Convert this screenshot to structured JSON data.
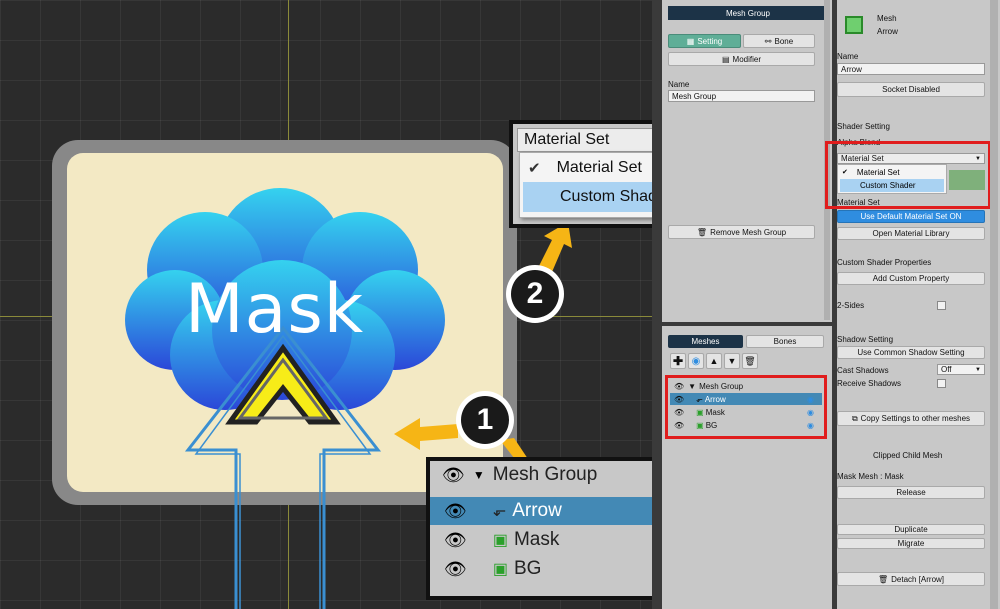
{
  "viewport": {
    "mask_label": "Mask",
    "callout1_number": "1",
    "callout2_number": "2"
  },
  "material_zoom": {
    "select_value": "Material Set",
    "options": [
      "Material Set",
      "Custom Shader"
    ],
    "selected_index": 0,
    "highlight_index": 1
  },
  "hierarchy_zoom": {
    "group_name": "Mesh Group",
    "items": [
      {
        "name": "Arrow",
        "selected": true
      },
      {
        "name": "Mask",
        "selected": false
      },
      {
        "name": "BG",
        "selected": false
      }
    ]
  },
  "mid_panel": {
    "header": "Mesh Group",
    "tab_setting": "Setting",
    "tab_bone": "Bone",
    "modifier_btn": "Modifier",
    "name_label": "Name",
    "name_value": "Mesh Group",
    "remove_btn": "Remove Mesh Group",
    "tab_meshes": "Meshes",
    "tab_bones": "Bones",
    "tree_group": "Mesh Group",
    "tree_items": [
      "Arrow",
      "Mask",
      "BG"
    ]
  },
  "right_panel": {
    "mesh_type": "Mesh",
    "mesh_name": "Arrow",
    "name_label": "Name",
    "name_value": "Arrow",
    "socket_btn": "Socket Disabled",
    "shader_setting": "Shader Setting",
    "alpha_blend": "Alpha Blend",
    "shader_select": "Material Set",
    "dropdown_options": [
      "Material Set",
      "Custom Shader"
    ],
    "material_set_label": "Material Set",
    "use_default_btn": "Use Default Material Set ON",
    "open_library_btn": "Open Material Library",
    "custom_shader_props": "Custom Shader Properties",
    "add_custom_property_btn": "Add Custom Property",
    "two_sides": "2-Sides",
    "shadow_setting": "Shadow Setting",
    "use_common_shadow_btn": "Use Common Shadow Setting",
    "cast_shadows": "Cast Shadows",
    "cast_shadows_value": "Off",
    "receive_shadows": "Receive Shadows",
    "copy_settings_btn": "Copy Settings to other meshes",
    "clipped_child": "Clipped Child Mesh",
    "mask_mesh": "Mask Mesh : Mask",
    "release_btn": "Release",
    "duplicate_btn": "Duplicate",
    "migrate_btn": "Migrate",
    "detach_btn": "Detach [Arrow]"
  },
  "colors": {
    "accent_blue": "#3a8fd1",
    "highlight_row": "#4389b5",
    "red_outline": "#e01d1d",
    "arrow_yellow": "#f6b515",
    "swatch_green": "#7fb07b"
  }
}
